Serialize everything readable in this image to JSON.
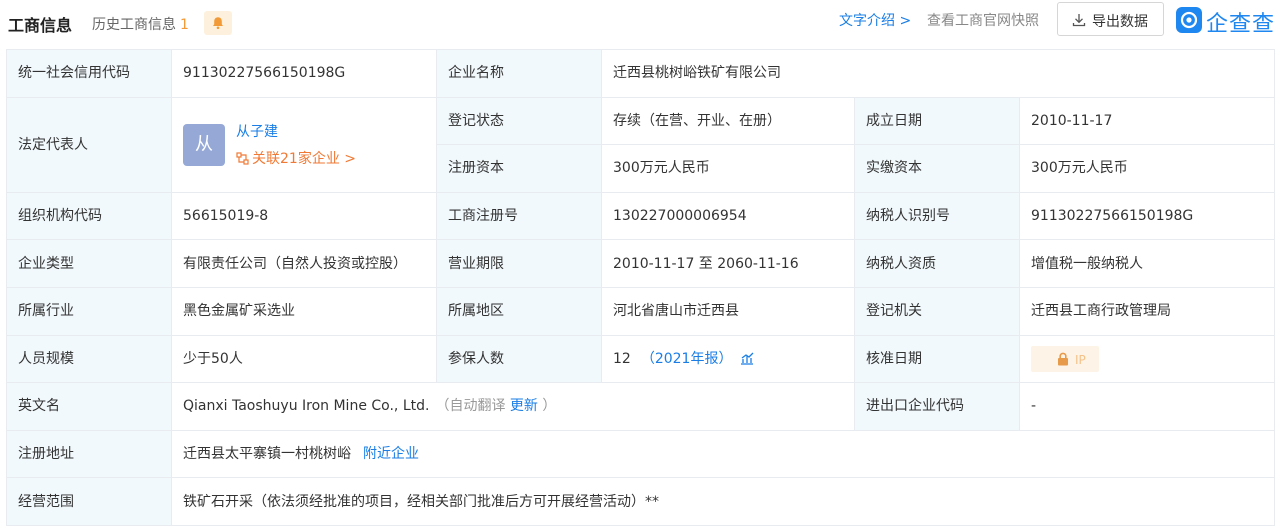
{
  "header": {
    "title": "工商信息",
    "history_label": "历史工商信息",
    "history_count": "1",
    "text_intro": "文字介绍 >",
    "snapshot": "查看工商官网快照",
    "export": "导出数据",
    "logo_text": "企查查"
  },
  "colors": {
    "accent": "#1a7ee6",
    "label_bg": "#f2f9fc",
    "orange": "#f07a35"
  },
  "rows": {
    "credit_code_label": "统一社会信用代码",
    "credit_code": "91130227566150198G",
    "company_name_label": "企业名称",
    "company_name": "迁西县桃树峪铁矿有限公司",
    "legal_rep_label": "法定代表人",
    "legal_rep_avatar": "从",
    "legal_rep_name": "从子建",
    "legal_rep_related": "关联21家企业 >",
    "reg_status_label": "登记状态",
    "reg_status": "存续（在营、开业、在册）",
    "found_date_label": "成立日期",
    "found_date": "2010-11-17",
    "reg_capital_label": "注册资本",
    "reg_capital": "300万元人民币",
    "paid_capital_label": "实缴资本",
    "paid_capital": "300万元人民币",
    "org_code_label": "组织机构代码",
    "org_code": "56615019-8",
    "biz_reg_no_label": "工商注册号",
    "biz_reg_no": "130227000006954",
    "taxpayer_id_label": "纳税人识别号",
    "taxpayer_id": "91130227566150198G",
    "company_type_label": "企业类型",
    "company_type": "有限责任公司（自然人投资或控股）",
    "biz_term_label": "营业期限",
    "biz_term": "2010-11-17 至 2060-11-16",
    "taxpayer_qual_label": "纳税人资质",
    "taxpayer_qual": "增值税一般纳税人",
    "industry_label": "所属行业",
    "industry": "黑色金属矿采选业",
    "region_label": "所属地区",
    "region": "河北省唐山市迁西县",
    "reg_authority_label": "登记机关",
    "reg_authority": "迁西县工商行政管理局",
    "staff_size_label": "人员规模",
    "staff_size": "少于50人",
    "insured_label": "参保人数",
    "insured_count": "12",
    "insured_year": "（2021年报）",
    "approve_date_label": "核准日期",
    "approve_vip": "IP",
    "english_name_label": "英文名",
    "english_name": "Qianxi Taoshuyu Iron Mine Co., Ltd.",
    "auto_translate": "（自动翻译",
    "update_link": "更新",
    "auto_translate_close": "）",
    "ie_code_label": "进出口企业代码",
    "ie_code": "-",
    "address_label": "注册地址",
    "address": "迁西县太平寨镇一村桃树峪",
    "nearby_link": "附近企业",
    "scope_label": "经营范围",
    "scope": "铁矿石开采（依法须经批准的项目，经相关部门批准后方可开展经营活动）**"
  }
}
